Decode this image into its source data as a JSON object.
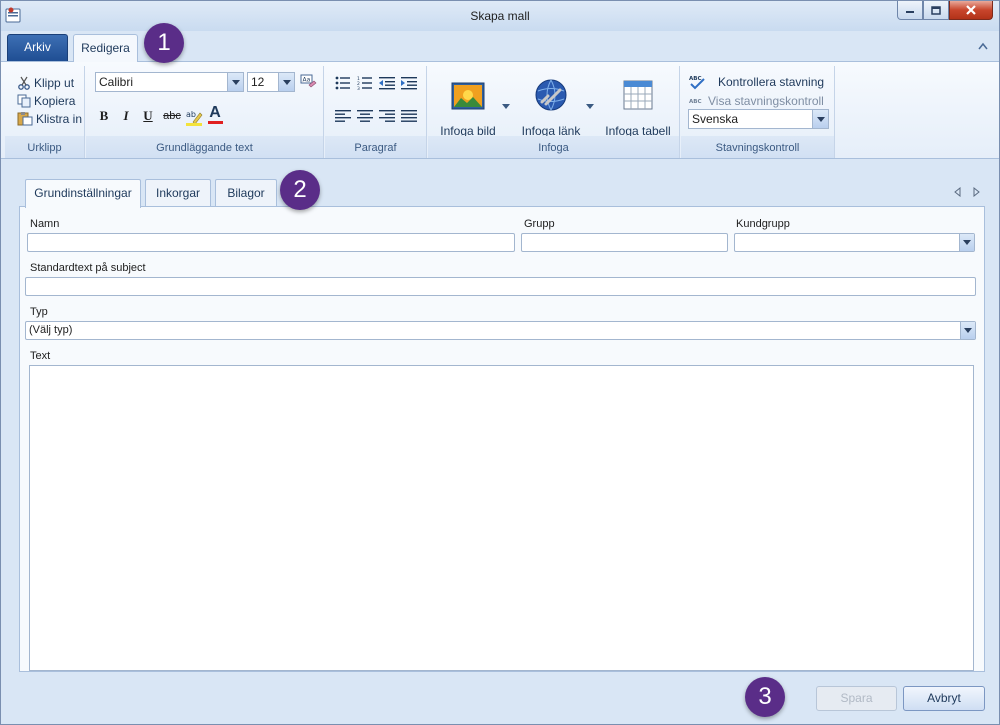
{
  "window": {
    "title": "Skapa mall"
  },
  "ribbon_tabs": {
    "arkiv": "Arkiv",
    "redigera": "Redigera"
  },
  "clipboard": {
    "cut": "Klipp ut",
    "copy": "Kopiera",
    "paste": "Klistra in",
    "label": "Urklipp"
  },
  "font": {
    "family": "Calibri",
    "size": "12",
    "label": "Grundläggande text",
    "bold": "B",
    "italic": "I",
    "underline": "U",
    "strike": "abc",
    "color_glyph": "A"
  },
  "paragraph": {
    "label": "Paragraf"
  },
  "insert": {
    "image": "Infoga bild",
    "link": "Infoga länk",
    "table": "Infoga tabell",
    "label": "Infoga"
  },
  "spelling": {
    "check": "Kontrollera stavning",
    "show": "Visa stavningskontroll",
    "language": "Svenska",
    "label": "Stavningskontroll",
    "abc": "ABC"
  },
  "content_tabs": [
    "Grundinställningar",
    "Inkorgar",
    "Bilagor"
  ],
  "form": {
    "name_label": "Namn",
    "name_value": "",
    "group_label": "Grupp",
    "group_value": "",
    "customer_group_label": "Kundgrupp",
    "customer_group_value": "",
    "subject_label": "Standardtext på subject",
    "subject_value": "",
    "type_label": "Typ",
    "type_value": "(Välj typ)",
    "text_label": "Text"
  },
  "buttons": {
    "save": "Spara",
    "cancel": "Avbryt"
  },
  "badges": [
    "1",
    "2",
    "3"
  ],
  "colors": {
    "badge": "#5a2d88",
    "accent": "#1f4e93"
  }
}
